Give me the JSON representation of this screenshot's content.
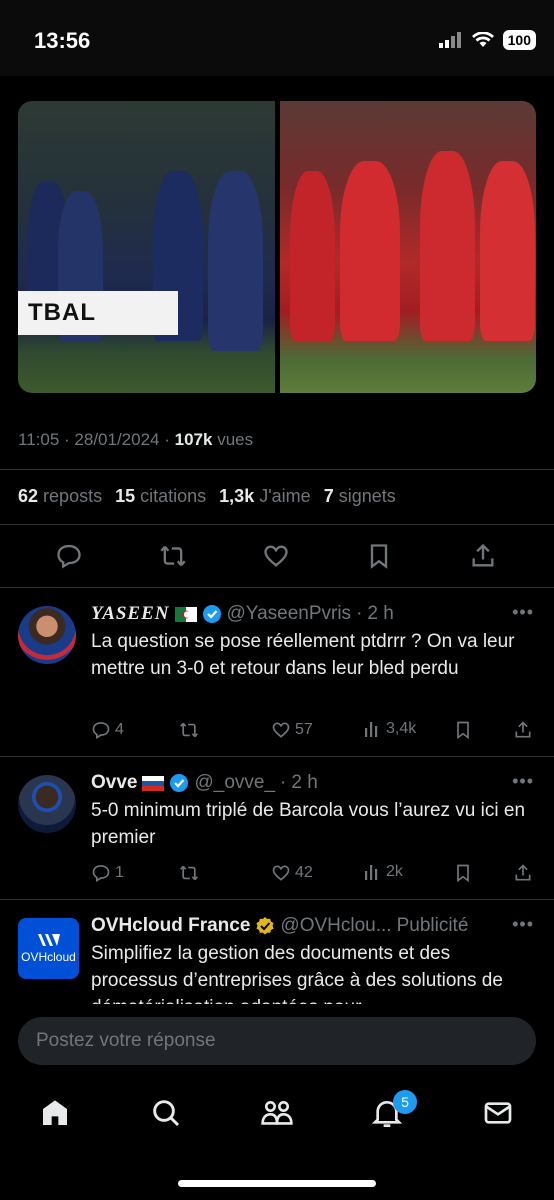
{
  "status_bar": {
    "time": "13:56",
    "battery": "100"
  },
  "tweet": {
    "time": "11:05",
    "date": "28/01/2024",
    "views_count": "107k",
    "views_label": "vues",
    "stats": {
      "reposts_count": "62",
      "reposts_label": "reposts",
      "quotes_count": "15",
      "quotes_label": "citations",
      "likes_count": "1,3k",
      "likes_label": "J'aime",
      "bookmarks_count": "7",
      "bookmarks_label": "signets"
    },
    "media": {
      "banner_text": "TBAL"
    }
  },
  "replies": [
    {
      "name": "YASEEN",
      "flag": "algeria-flag",
      "handle": "@YaseenPvris",
      "age": "2 h",
      "text": "La question se pose réellement ptdrrr ? On va leur mettre un 3-0 et retour dans leur bled perdu",
      "replies": "4",
      "likes": "57",
      "views": "3,4k"
    },
    {
      "name": "Ovve",
      "flag": "russia-flag",
      "handle": "@_ovve_",
      "age": "2 h",
      "text": "5-0 minimum triplé de Barcola vous l’aurez vu ici en premier",
      "replies": "1",
      "likes": "42",
      "views": "2k"
    }
  ],
  "ad": {
    "name": "OVHcloud France",
    "handle": "@OVHclou...",
    "label": "Publicité",
    "logo_text": "OVHcloud",
    "text": "Simplifiez la gestion des documents et des processus d’entreprises grâce à des solutions de dématérialisation adaptées pour"
  },
  "composer": {
    "placeholder": "Postez votre réponse"
  },
  "bottom_nav": {
    "notifications_badge": "5"
  },
  "colors": {
    "accent": "#1d9bf0",
    "verified_gold": "#e2b719",
    "muted": "#71767b"
  }
}
